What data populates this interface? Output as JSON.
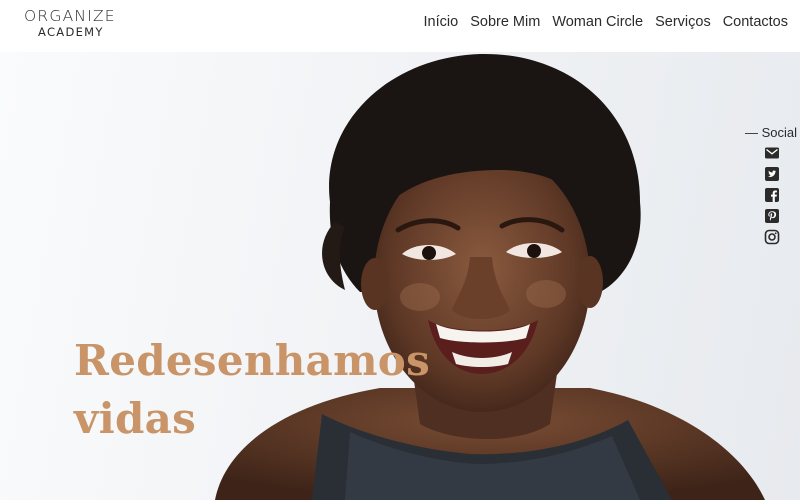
{
  "header": {
    "logo": {
      "main": "ORGANIZE",
      "sub": "ACADEMY"
    },
    "nav": [
      {
        "label": "Início"
      },
      {
        "label": "Sobre Mim"
      },
      {
        "label": "Woman Circle"
      },
      {
        "label": "Serviços"
      },
      {
        "label": "Contactos"
      }
    ]
  },
  "hero": {
    "headline_line1": "Redesenhamos",
    "headline_line2": "vidas",
    "headline_color": "#c99468"
  },
  "social": {
    "label": "— Social",
    "icons": [
      "email-icon",
      "twitter-icon",
      "facebook-icon",
      "pinterest-icon",
      "instagram-icon"
    ]
  }
}
